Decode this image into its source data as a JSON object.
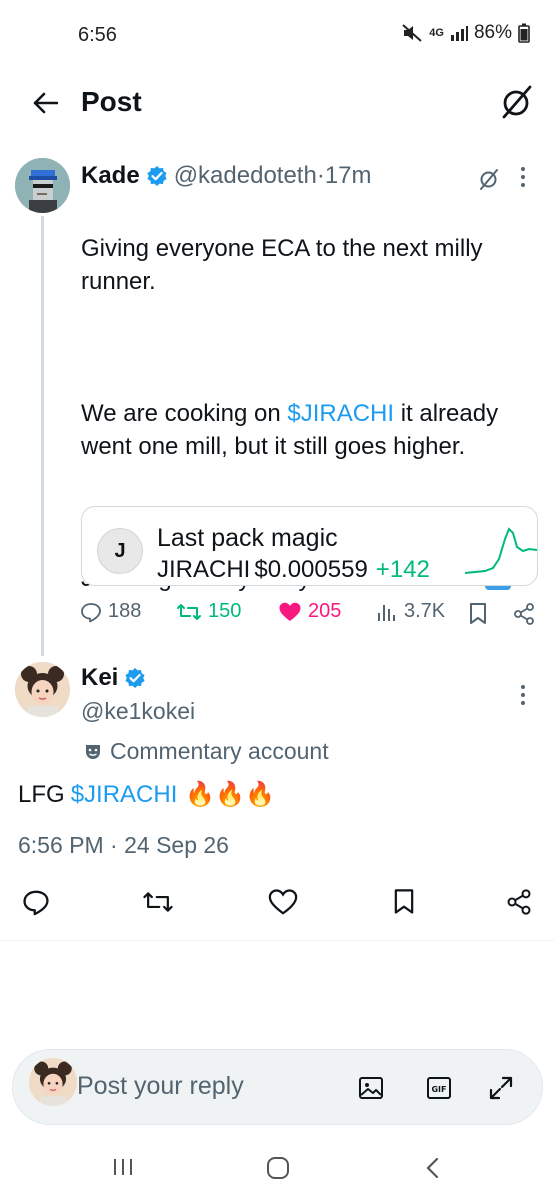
{
  "status": {
    "time": "6:56",
    "network": "4G",
    "battery": "86%"
  },
  "header": {
    "title": "Post"
  },
  "kade": {
    "name": "Kade",
    "handle": "@kadedoteth",
    "sep": " · ",
    "time": "17m",
    "text_1": "Giving everyone ECA to the next milly runner.",
    "text_2a": "We are cooking on ",
    "text_2_link": "$JIRACHI",
    "text_2b": " it already went one mill, but it still goes higher.",
    "text_3": "Join to get early entry on the next one",
    "card": {
      "initial": "J",
      "title": "Last pack magic",
      "ticker": "JIRACHI",
      "price": "$0.000559",
      "change": "+142"
    },
    "stats": {
      "replies": "188",
      "reposts": "150",
      "likes": "205",
      "views": "3.7K"
    }
  },
  "kei": {
    "name": "Kei",
    "handle": "@ke1kokei",
    "commentary": "Commentary account",
    "text_a": "LFG ",
    "text_link": "$JIRACHI",
    "emoji": "🔥🔥🔥",
    "timestamp": "6:56 PM · 24 Sep 26"
  },
  "reply": {
    "placeholder": "Post your reply"
  },
  "colors": {
    "link": "#1d9bf0",
    "repost": "#00ba7c",
    "like": "#f91880",
    "muted": "#536471"
  },
  "icons": [
    "back-arrow-icon",
    "grok-icon",
    "verified-icon",
    "more-icon",
    "reply-icon",
    "repost-icon",
    "like-icon",
    "views-icon",
    "bookmark-icon",
    "share-icon",
    "image-icon",
    "gif-icon",
    "expand-icon"
  ]
}
